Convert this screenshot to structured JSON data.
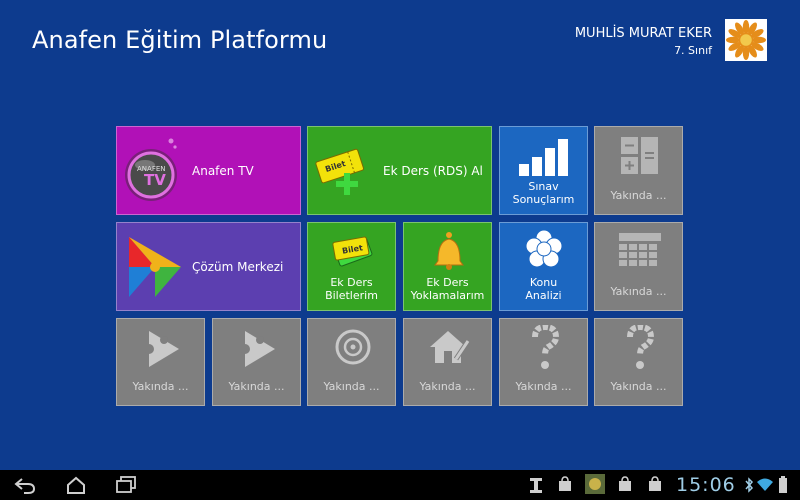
{
  "header": {
    "title": "Anafen Eğitim Platformu",
    "user_name": "MUHLİS MURAT EKER",
    "user_grade": "7. Sınıf"
  },
  "tiles": {
    "anafen_tv": {
      "label": "Anafen TV",
      "icon": "tv-orb-icon",
      "badge_top": "ANAFEN",
      "badge_bottom": "TV"
    },
    "ek_ders_al": {
      "label": "Ek Ders (RDS) Al",
      "icon": "ticket-plus-icon",
      "ticket_text": "Bilet"
    },
    "sinav_sonuclarim": {
      "label": "Sınav Sonuçlarım",
      "icon": "bar-signal-icon"
    },
    "soon_calculator": {
      "label": "Yakında ...",
      "icon": "calculator-icon"
    },
    "cozum_merkezi": {
      "label": "Çözüm Merkezi",
      "icon": "puzzle-triangle-icon"
    },
    "ek_ders_biletlerim": {
      "label": "Ek Ders Biletlerim",
      "icon": "tickets-icon",
      "ticket_text": "Bilet"
    },
    "ek_ders_yoklamalarim": {
      "label": "Ek Ders Yoklamalarım",
      "icon": "bell-icon"
    },
    "konu_analizi": {
      "label": "Konu Analizi",
      "icon": "flower-icon"
    },
    "soon_calendar": {
      "label": "Yakında ...",
      "icon": "calendar-icon"
    },
    "soon_play_1": {
      "label": "Yakında ...",
      "icon": "play-puzzle-icon"
    },
    "soon_play_2": {
      "label": "Yakında ...",
      "icon": "play-puzzle-icon"
    },
    "soon_target": {
      "label": "Yakında ...",
      "icon": "target-icon"
    },
    "soon_home": {
      "label": "Yakında ...",
      "icon": "home-pencil-icon"
    },
    "soon_question_1": {
      "label": "Yakında ...",
      "icon": "question-icon"
    },
    "soon_question_2": {
      "label": "Yakında ...",
      "icon": "question-icon"
    }
  },
  "navbar": {
    "clock": "15:06",
    "icons": [
      "back-icon",
      "home-icon",
      "recent-apps-icon",
      "usb-icon",
      "bag-icon",
      "app-thumbnail-icon",
      "bag-icon",
      "bag-icon",
      "bluetooth-icon",
      "wifi-icon",
      "battery-icon"
    ]
  },
  "colors": {
    "background": "#0d3b8e",
    "purple": "#b111b7",
    "green": "#35a422",
    "blue": "#1c67c1",
    "violet": "#5c3fb0",
    "gray": "#7f7f7f"
  }
}
